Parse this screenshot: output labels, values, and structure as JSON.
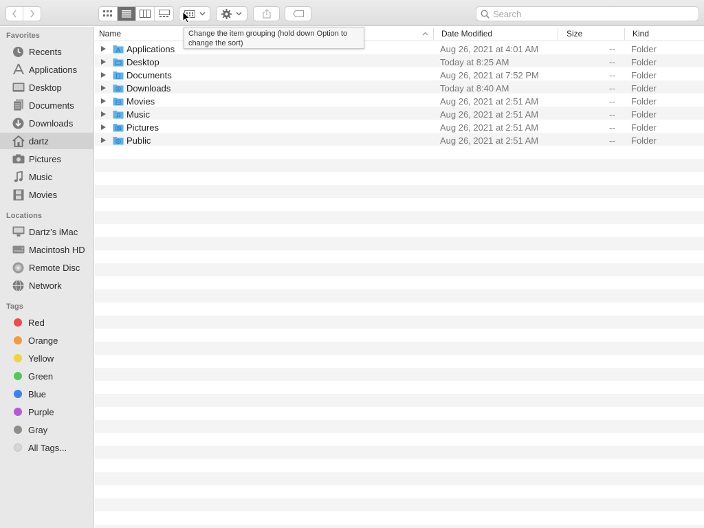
{
  "toolbar": {
    "back_icon": "chevron-left-icon",
    "forward_icon": "chevron-right-icon",
    "view_icons": [
      "icon-view-icon",
      "list-view-icon",
      "column-view-icon",
      "gallery-view-icon"
    ],
    "group_icon": "group-grid-icon",
    "action_icon": "gear-icon",
    "share_icon": "share-icon",
    "tag_icon": "tag-icon",
    "search": {
      "placeholder": "Search",
      "value": ""
    }
  },
  "tooltip": {
    "text": "Change the item grouping (hold down Option to change the sort)"
  },
  "sidebar": {
    "favorites_label": "Favorites",
    "favorites": [
      {
        "label": "Recents",
        "icon": "clock-icon"
      },
      {
        "label": "Applications",
        "icon": "applications-icon"
      },
      {
        "label": "Desktop",
        "icon": "desktop-icon"
      },
      {
        "label": "Documents",
        "icon": "document-icon"
      },
      {
        "label": "Downloads",
        "icon": "download-icon"
      },
      {
        "label": "dartz",
        "icon": "home-icon",
        "selected": true
      },
      {
        "label": "Pictures",
        "icon": "camera-icon"
      },
      {
        "label": "Music",
        "icon": "music-note-icon"
      },
      {
        "label": "Movies",
        "icon": "film-icon"
      }
    ],
    "locations_label": "Locations",
    "locations": [
      {
        "label": "Dartz’s iMac",
        "icon": "imac-icon"
      },
      {
        "label": "Macintosh HD",
        "icon": "hard-drive-icon"
      },
      {
        "label": "Remote Disc",
        "icon": "disc-icon"
      },
      {
        "label": "Network",
        "icon": "globe-icon"
      }
    ],
    "tags_label": "Tags",
    "tags": [
      {
        "label": "Red",
        "color": "#ef4b4b"
      },
      {
        "label": "Orange",
        "color": "#f5993b"
      },
      {
        "label": "Yellow",
        "color": "#f1d43a"
      },
      {
        "label": "Green",
        "color": "#54c758"
      },
      {
        "label": "Blue",
        "color": "#3b82f0"
      },
      {
        "label": "Purple",
        "color": "#b55ad6"
      },
      {
        "label": "Gray",
        "color": "#8e8e8e"
      },
      {
        "label": "All Tags...",
        "color": "#d6d6d6"
      }
    ]
  },
  "columns": {
    "name": "Name",
    "date": "Date Modified",
    "size": "Size",
    "kind": "Kind"
  },
  "files": [
    {
      "name": "Applications",
      "date": "Aug 26, 2021 at 4:01 AM",
      "size": "--",
      "kind": "Folder",
      "icon": "applications-folder-icon"
    },
    {
      "name": "Desktop",
      "date": "Today at 8:25 AM",
      "size": "--",
      "kind": "Folder",
      "icon": "desktop-folder-icon"
    },
    {
      "name": "Documents",
      "date": "Aug 26, 2021 at 7:52 PM",
      "size": "--",
      "kind": "Folder",
      "icon": "documents-folder-icon"
    },
    {
      "name": "Downloads",
      "date": "Today at 8:40 AM",
      "size": "--",
      "kind": "Folder",
      "icon": "downloads-folder-icon"
    },
    {
      "name": "Movies",
      "date": "Aug 26, 2021 at 2:51 AM",
      "size": "--",
      "kind": "Folder",
      "icon": "movies-folder-icon"
    },
    {
      "name": "Music",
      "date": "Aug 26, 2021 at 2:51 AM",
      "size": "--",
      "kind": "Folder",
      "icon": "music-folder-icon"
    },
    {
      "name": "Pictures",
      "date": "Aug 26, 2021 at 2:51 AM",
      "size": "--",
      "kind": "Folder",
      "icon": "pictures-folder-icon"
    },
    {
      "name": "Public",
      "date": "Aug 26, 2021 at 2:51 AM",
      "size": "--",
      "kind": "Folder",
      "icon": "public-folder-icon"
    }
  ],
  "colors": {
    "folder": "#5fb2ec",
    "sidebar_bg": "#e8e8e8",
    "selected": "#d2d2d2"
  }
}
